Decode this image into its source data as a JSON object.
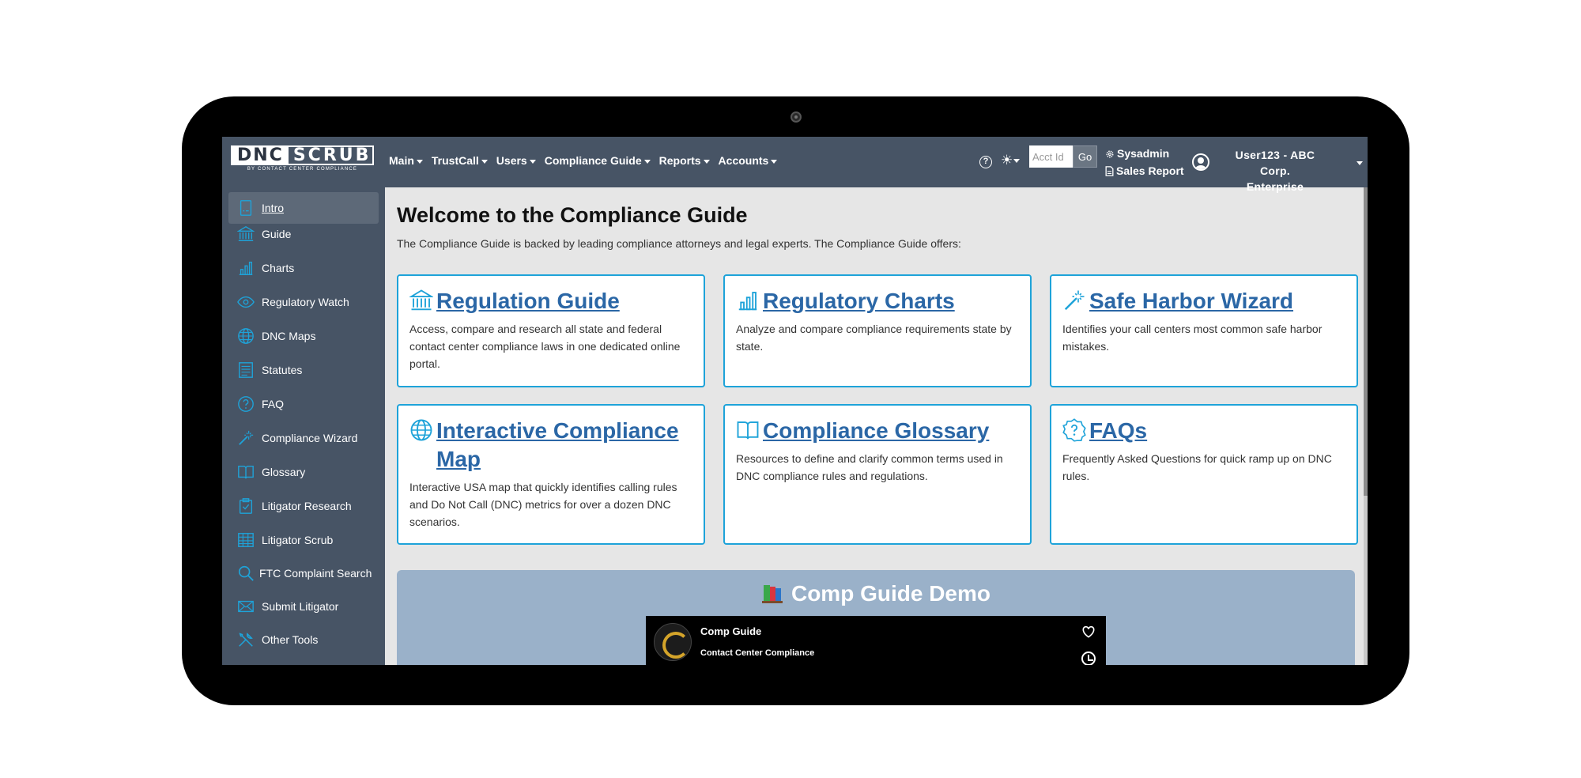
{
  "header": {
    "logo_left": "DNC",
    "logo_right": "SCRUB",
    "logo_tagline": "BY CONTACT CENTER COMPLIANCE",
    "nav": [
      {
        "label": "Main"
      },
      {
        "label": "TrustCall"
      },
      {
        "label": "Users"
      },
      {
        "label": "Compliance Guide"
      },
      {
        "label": "Reports"
      },
      {
        "label": "Accounts"
      }
    ],
    "theme_icon": "☀",
    "acct_placeholder": "Acct Id",
    "go_label": "Go",
    "sysadmin": "Sysadmin",
    "sales_report": "Sales Report",
    "user_line1": "User123 - ABC Corp.",
    "user_line2": "Enterprise"
  },
  "sidebar": {
    "items": [
      {
        "label": "Intro",
        "icon": "intro-icon"
      },
      {
        "label": "Guide",
        "icon": "building-icon"
      },
      {
        "label": "Charts",
        "icon": "bar-chart-icon"
      },
      {
        "label": "Regulatory Watch",
        "icon": "eye-icon"
      },
      {
        "label": "DNC Maps",
        "icon": "globe-icon"
      },
      {
        "label": "Statutes",
        "icon": "document-icon"
      },
      {
        "label": "FAQ",
        "icon": "question-icon"
      },
      {
        "label": "Compliance Wizard",
        "icon": "wand-icon"
      },
      {
        "label": "Glossary",
        "icon": "book-icon"
      },
      {
        "label": "Litigator Research",
        "icon": "clipboard-icon"
      },
      {
        "label": "Litigator Scrub",
        "icon": "table-icon"
      },
      {
        "label": "FTC Complaint Search",
        "icon": "search-icon"
      },
      {
        "label": "Submit Litigator",
        "icon": "envelope-icon"
      },
      {
        "label": "Other Tools",
        "icon": "tools-icon"
      }
    ]
  },
  "main": {
    "title": "Welcome to the Compliance Guide",
    "subtitle": "The Compliance Guide is backed by leading compliance attorneys and legal experts. The Compliance Guide offers:",
    "cards": [
      {
        "title": "Regulation Guide",
        "desc": "Access, compare and research all state and federal contact center compliance laws in one dedicated online portal.",
        "icon": "building-icon"
      },
      {
        "title": "Regulatory Charts",
        "desc": "Analyze and compare compliance requirements state by state.",
        "icon": "bar-chart-icon"
      },
      {
        "title": "Safe Harbor Wizard",
        "desc": "Identifies your call centers most common safe harbor mistakes.",
        "icon": "wand-icon"
      },
      {
        "title": "Interactive Compliance Map",
        "desc": "Interactive USA map that quickly identifies calling rules and Do Not Call (DNC) metrics for over a dozen DNC scenarios.",
        "icon": "globe-icon"
      },
      {
        "title": "Compliance Glossary",
        "desc": "Resources to define and clarify common terms used in DNC compliance rules and regulations.",
        "icon": "book-icon"
      },
      {
        "title": "FAQs",
        "desc": "Frequently Asked Questions for quick ramp up on DNC rules.",
        "icon": "question-icon"
      }
    ],
    "demo": {
      "title": "Comp Guide Demo",
      "video_title": "Comp Guide",
      "video_channel": "Contact Center Compliance"
    }
  },
  "colors": {
    "accent": "#1ea3d9",
    "link": "#2b67a6",
    "sidebar_bg": "#475465",
    "demo_bg": "#9ab1c9"
  }
}
